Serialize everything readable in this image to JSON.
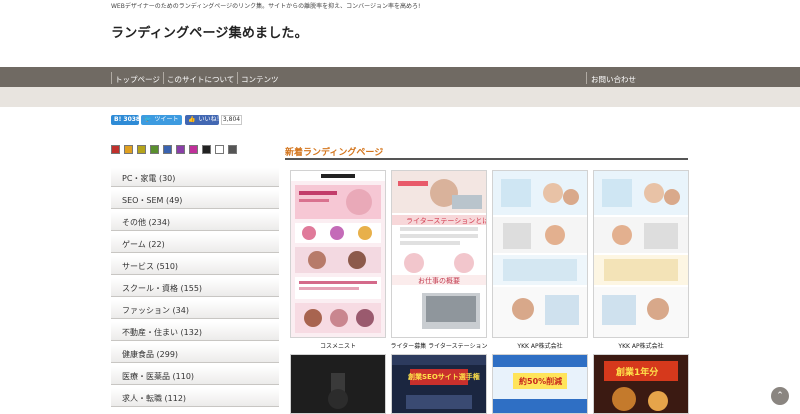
{
  "header": {
    "tagline": "WEBデザイナーのためのランディングページのリンク集。サイトからの離脱率を抑え、コンバージョン率を高めろ!",
    "title": "ランディングページ集めました。"
  },
  "nav": {
    "items": [
      "トップページ",
      "このサイトについて",
      "コンテンツ"
    ],
    "contact": "お問い合わせ"
  },
  "share": {
    "hatena": "B! 3038",
    "tweet": "ツイート",
    "like": "いいね！",
    "like_count": "3,804"
  },
  "color_filters": [
    "#c0302c",
    "#e0a020",
    "#b5a41b",
    "#5a8f2e",
    "#3a63b0",
    "#8a3fa8",
    "#c0309a",
    "#222222",
    "#ffffff",
    "#555555"
  ],
  "categories": [
    {
      "label": "PC・家電 (30)"
    },
    {
      "label": "SEO・SEM (49)"
    },
    {
      "label": "その他 (234)"
    },
    {
      "label": "ゲーム (22)"
    },
    {
      "label": "サービス (510)"
    },
    {
      "label": "スクール・資格 (155)"
    },
    {
      "label": "ファッション (34)"
    },
    {
      "label": "不動産・住まい (132)"
    },
    {
      "label": "健康食品 (299)"
    },
    {
      "label": "医療・医薬品 (110)"
    },
    {
      "label": "求人・転職 (112)"
    }
  ],
  "main": {
    "heading": "新着ランディングページ",
    "items": [
      {
        "caption": "コスメニスト"
      },
      {
        "caption": "ライター募集 ライターステーション",
        "banner": "ライターステーションとは",
        "sub": "お仕事の概要"
      },
      {
        "caption": "YKK AP株式会社"
      },
      {
        "caption": "YKK AP株式会社"
      },
      {
        "caption": ""
      },
      {
        "caption": "",
        "banner": "創業SEOサイト選手権"
      },
      {
        "caption": "",
        "banner": "約50%削減"
      },
      {
        "caption": "",
        "banner": "創業1年分"
      }
    ]
  }
}
